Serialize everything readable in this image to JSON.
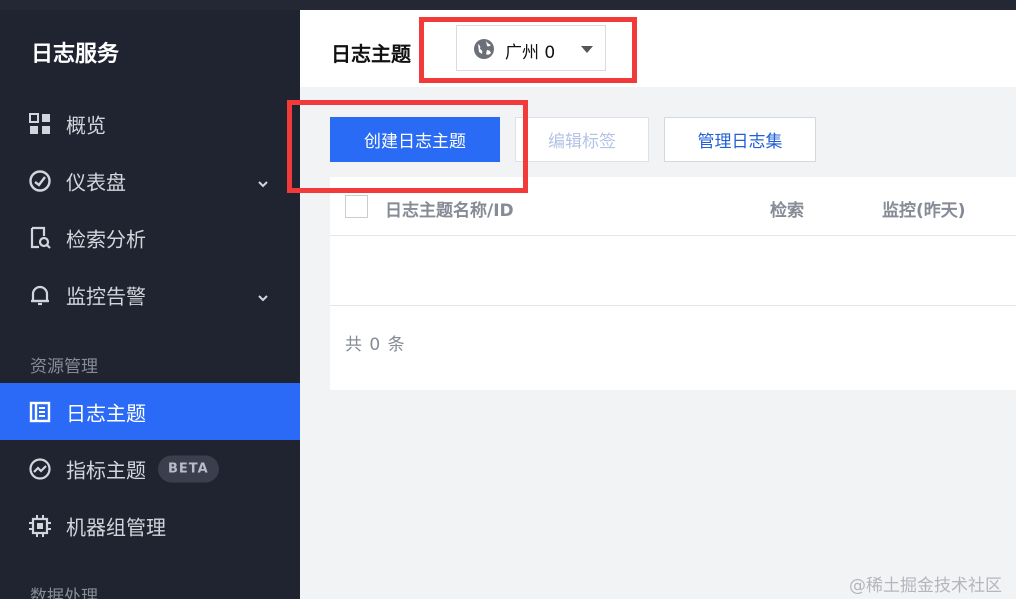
{
  "sidebar": {
    "brand": "日志服务",
    "items": [
      {
        "label": "概览"
      },
      {
        "label": "仪表盘"
      },
      {
        "label": "检索分析"
      },
      {
        "label": "监控告警"
      },
      {
        "label": "日志主题"
      },
      {
        "label": "指标主题",
        "badge": "BETA"
      },
      {
        "label": "机器组管理"
      }
    ],
    "sections": {
      "resource": "资源管理",
      "data_processing": "数据处理"
    }
  },
  "header": {
    "title": "日志主题",
    "region": "广州 0"
  },
  "toolbar": {
    "create_label": "创建日志主题",
    "edit_tags_label": "编辑标签",
    "manage_logsets_label": "管理日志集"
  },
  "table": {
    "columns": [
      "日志主题名称/ID",
      "检索",
      "监控(昨天)"
    ],
    "footer": "共 0 条"
  },
  "watermark": "@稀土掘金技术社区",
  "colors": {
    "sidebar_bg": "#202431",
    "active_blue": "#2b6af6",
    "highlight_red": "#f23a3a"
  }
}
